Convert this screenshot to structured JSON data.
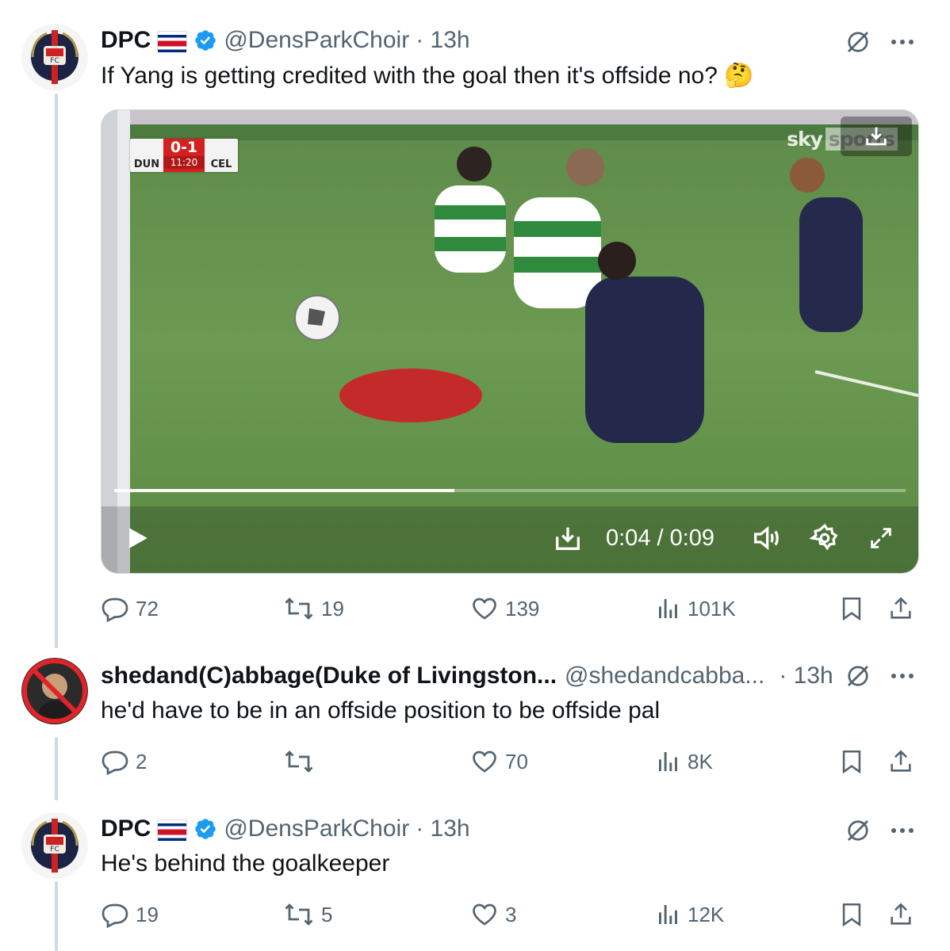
{
  "tweets": [
    {
      "name": "DPC",
      "handle": "@DensParkChoir",
      "time": "· 13h",
      "text": "If Yang is getting credited with the goal then it's offside no? 🤔",
      "replies": "72",
      "retweets": "19",
      "likes": "139",
      "views": "101K"
    },
    {
      "name": "shedand(C)abbage(Duke of Livingston...",
      "handle": "@shedandcabba...",
      "time": "· 13h",
      "text": "he'd have to be in an offside position to be offside pal",
      "replies": "2",
      "retweets": "",
      "likes": "70",
      "views": "8K"
    },
    {
      "name": "DPC",
      "handle": "@DensParkChoir",
      "time": "· 13h",
      "text": "He's behind the goalkeeper",
      "replies": "19",
      "retweets": "5",
      "likes": "3",
      "views": "12K"
    }
  ],
  "video": {
    "scorebug": {
      "home": "DUN",
      "away": "CEL",
      "score": "0-1",
      "clock": "11:20"
    },
    "broadcaster": "sky",
    "broadcaster_suffix": "sports",
    "time_display": "0:04 / 0:09",
    "progress": 0.43
  },
  "icons": {
    "verified": "verified-badge-icon",
    "flag": "costa-rica-flag-icon",
    "grok": "grok-icon",
    "more": "more-icon",
    "reply": "reply-icon",
    "retweet": "retweet-icon",
    "like": "heart-icon",
    "views": "views-icon",
    "bookmark": "bookmark-icon",
    "share": "share-icon"
  },
  "colors": {
    "text": "#0f1419",
    "secondary": "#536471",
    "verified": "#1d9bf0",
    "line": "#cfd9de"
  }
}
